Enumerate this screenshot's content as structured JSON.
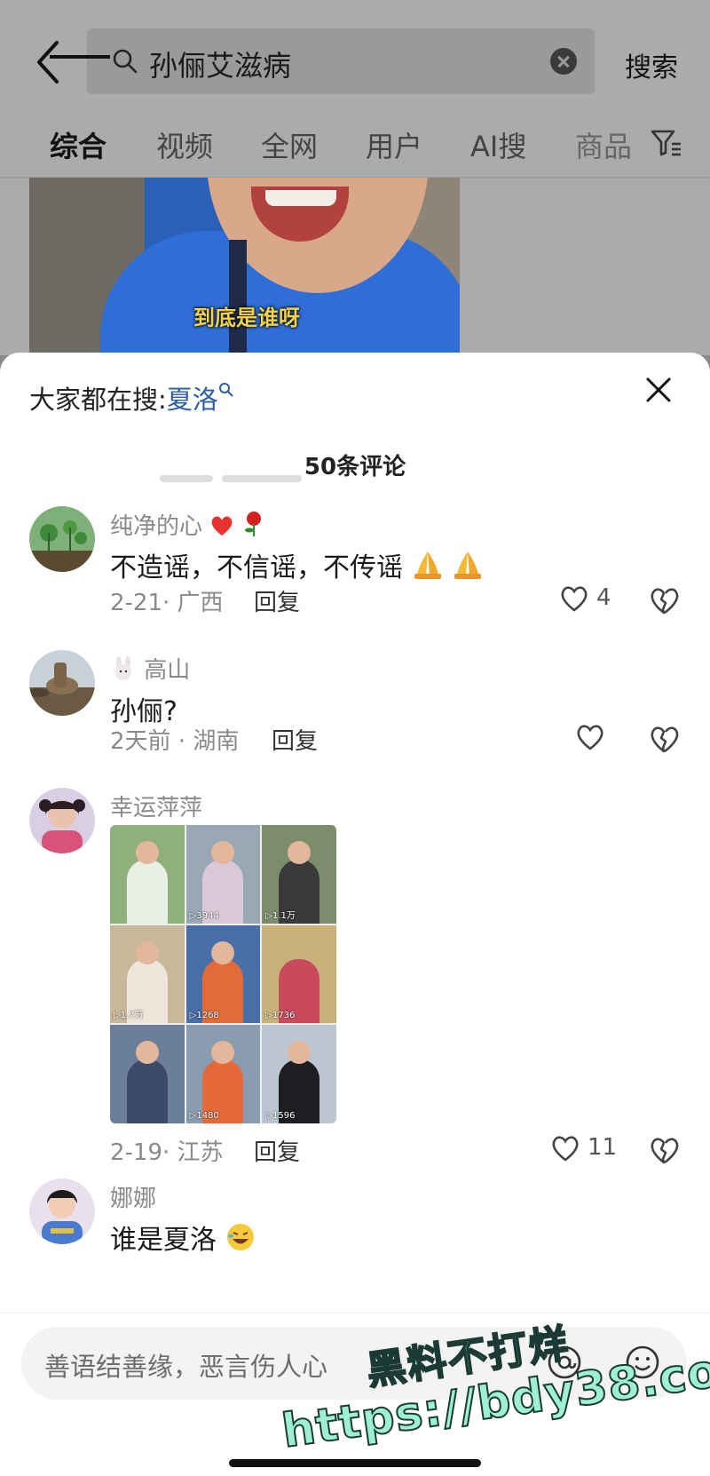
{
  "search": {
    "query": "孙俪艾滋病",
    "button_label": "搜索"
  },
  "tabs": [
    "综合",
    "视频",
    "全网",
    "用户",
    "AI搜",
    "商品"
  ],
  "video": {
    "caption": "到底是谁呀"
  },
  "sheet": {
    "hint_prefix": "大家都在搜:",
    "hint_keyword": "夏洛",
    "title": "50条评论"
  },
  "comments": [
    {
      "user": "纯净的心",
      "text": "不造谣，不信谣，不传谣",
      "date": "2-21",
      "region": "广西",
      "reply_label": "回复",
      "likes": "4"
    },
    {
      "user": "高山",
      "text": "孙俪?",
      "date": "2天前",
      "region": "湖南",
      "reply_label": "回复",
      "likes": ""
    },
    {
      "user": "幸运萍萍",
      "text": "",
      "date": "2-19",
      "region": "江苏",
      "reply_label": "回复",
      "likes": "11",
      "image_grid_views": [
        "",
        "3944",
        "1.1万",
        "1.7万",
        "1268",
        "1736",
        "",
        "1480",
        "1596"
      ]
    },
    {
      "user": "娜娜",
      "text": "谁是夏洛"
    }
  ],
  "input": {
    "placeholder": "善语结善缘，恶言伤人心"
  },
  "watermark": {
    "line1": "黑料不打烊",
    "line2": "https://bdy38.co"
  },
  "colors": {
    "keyword_blue": "#2b5fa3",
    "heart_red": "#e8322f"
  }
}
